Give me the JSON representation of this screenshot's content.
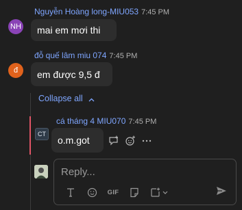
{
  "messages": [
    {
      "avatar_initials": "NH",
      "avatar_color": "#8a43b6",
      "sender": "Nguyễn Hoàng long-MIU053",
      "time": "7:45 PM",
      "text": "mai em mơi thi"
    },
    {
      "avatar_initials": "đ",
      "avatar_color": "#e0621c",
      "sender": "đỗ quế lâm miu 074",
      "time": "7:45 PM",
      "text": "em được 9,5 đ"
    }
  ],
  "thread": {
    "collapse_label": "Collapse all",
    "collapse_icon": "chevron-up-icon",
    "reply": {
      "avatar_initials": "CT",
      "sender": "cá tháng 4 MIU070",
      "time": "7:45 PM",
      "text": "o.m.got",
      "accent_color": "#e05566"
    }
  },
  "composer": {
    "placeholder": "Reply...",
    "gif_label": "GIF",
    "toolbar_icons": [
      "text-format-icon",
      "emoji-icon",
      "gif-icon",
      "sticker-icon",
      "loop-component-icon",
      "chevron-down-icon"
    ],
    "send_icon": "send-icon"
  },
  "colors": {
    "background": "#1f1f1f",
    "bubble": "#2d2d2d",
    "link": "#7fa6ff"
  }
}
